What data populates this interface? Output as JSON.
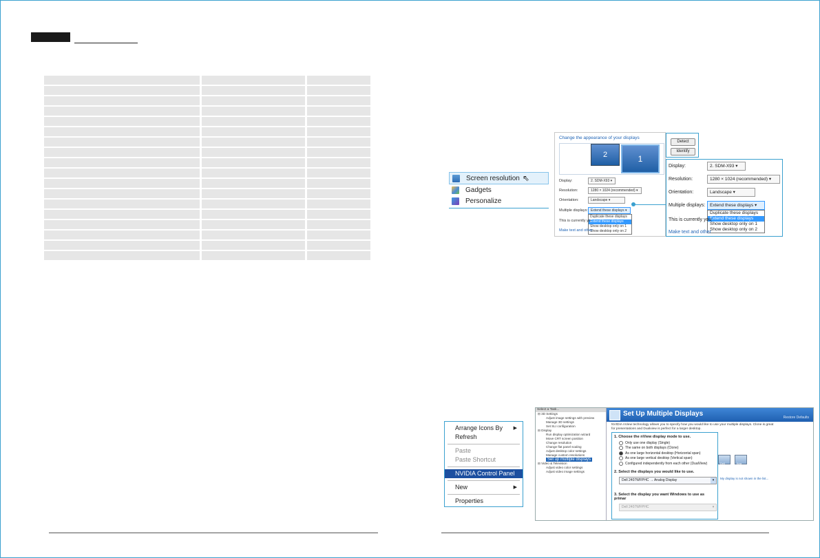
{
  "colors": {
    "accent": "#3aa0cf",
    "selection": "#3399ff",
    "nvidia_blue": "#1f5fb0"
  },
  "win7_context_menu": {
    "items": [
      {
        "label": "Screen resolution",
        "icon": "screen-resolution-icon",
        "highlighted": true
      },
      {
        "label": "Gadgets",
        "icon": "gadgets-icon"
      },
      {
        "label": "Personalize",
        "icon": "personalize-icon"
      }
    ]
  },
  "display_dialog": {
    "heading": "Change the appearance of your displays",
    "monitor_2": "2",
    "monitor_1": "1",
    "detect_label": "Detect",
    "identify_label": "Identify",
    "display_label": "Display:",
    "display_value": "2. SDM-X93",
    "resolution_label": "Resolution:",
    "resolution_value": "1280 × 1024 (recommended)",
    "orientation_label": "Orientation:",
    "orientation_value": "Landscape",
    "multiple_label": "Multiple displays:",
    "multiple_value": "Extend these displays",
    "options": [
      "Duplicate these displays",
      "Extend these displays",
      "Show desktop only on 1",
      "Show desktop only on 2"
    ],
    "selected_option": "Extend these displays",
    "currently_text": "This is currently yo",
    "link_text": "Make text and other"
  },
  "zoom_callout": {
    "detect_label": "Detect",
    "identify_label": "Identify",
    "display_label": "Display:",
    "display_value": "2. SDM-X93",
    "resolution_label": "Resolution:",
    "resolution_value": "1280 × 1024 (recommended)",
    "orientation_label": "Orientation:",
    "orientation_value": "Landscape",
    "multiple_label": "Multiple displays:",
    "multiple_value": "Extend these displays",
    "options": [
      "Duplicate these displays",
      "Extend these displays",
      "Show desktop only on 1",
      "Show desktop only on 2"
    ],
    "currently_text": "This is currently you",
    "link_text": "Make text and other"
  },
  "xp_context_menu": {
    "arrange_label": "Arrange Icons By",
    "refresh_label": "Refresh",
    "paste_label": "Paste",
    "paste_shortcut_label": "Paste Shortcut",
    "nvidia_label": "NVIDIA Control Panel",
    "new_label": "New",
    "properties_label": "Properties"
  },
  "nvidia_panel": {
    "task_header": "Select a Task...",
    "tree": {
      "settings_3d": "3D Settings",
      "adjust_image": "Adjust image settings with preview",
      "manage_3d": "Manage 3D settings",
      "set_sli": "Set SLI configuration",
      "display": "Display",
      "run_wizard": "Run display optimization wizard",
      "move_crt": "Move CRT screen position",
      "change_res": "Change resolution",
      "flat_panel": "Change flat panel scaling",
      "color_settings": "Adjust desktop color settings",
      "custom_res": "Manage custom resolutions",
      "setup_multi": "Set up multiple displays",
      "video_tv": "Video & Television",
      "video_color": "Adjust video color settings",
      "video_image": "Adjust video image settings"
    },
    "title": "Set Up Multiple Displays",
    "restore_defaults": "Restore Defaults",
    "description": "NVIDIA nView technology allows you to specify how you would like to use your multiple displays. Clone is great for presentations and Dualview is perfect for a larger desktop.",
    "step1": "1. Choose the nView display mode to use.",
    "modes": [
      {
        "label": "Only use one display (Single)",
        "checked": false
      },
      {
        "label": "The same on both displays (Clone)",
        "checked": false
      },
      {
        "label": "As one large horizontal desktop (Horizontal span)",
        "checked": true
      },
      {
        "label": "As one large vertical desktop (Vertical span)",
        "checked": false
      },
      {
        "label": "Configured independently from each other (DualView)",
        "checked": false
      }
    ],
    "step2": "2. Select the displays you would like to use.",
    "display_select": "Dell 2407WFPHC → Analog Display",
    "step3": "3. Select the display you want Windows to use as primar",
    "primary_select": "Dell 2407WFPHC",
    "monitor_a": "Dell",
    "monitor_b": "Ana",
    "not_shown_link": "My display is not shown in the list..."
  }
}
